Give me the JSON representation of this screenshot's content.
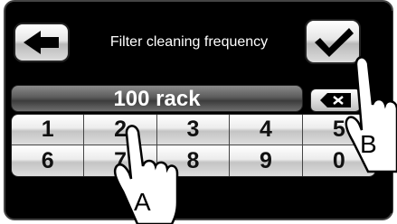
{
  "header": {
    "title": "Filter cleaning frequency",
    "back_icon": "arrow-left-icon",
    "confirm_icon": "checkmark-icon"
  },
  "value_display": {
    "value": "100 rack",
    "delete_icon": "backspace-icon"
  },
  "keypad": {
    "keys": [
      "1",
      "2",
      "3",
      "4",
      "5",
      "6",
      "7",
      "8",
      "9",
      "0"
    ]
  },
  "callouts": {
    "a": "A",
    "b": "B"
  }
}
